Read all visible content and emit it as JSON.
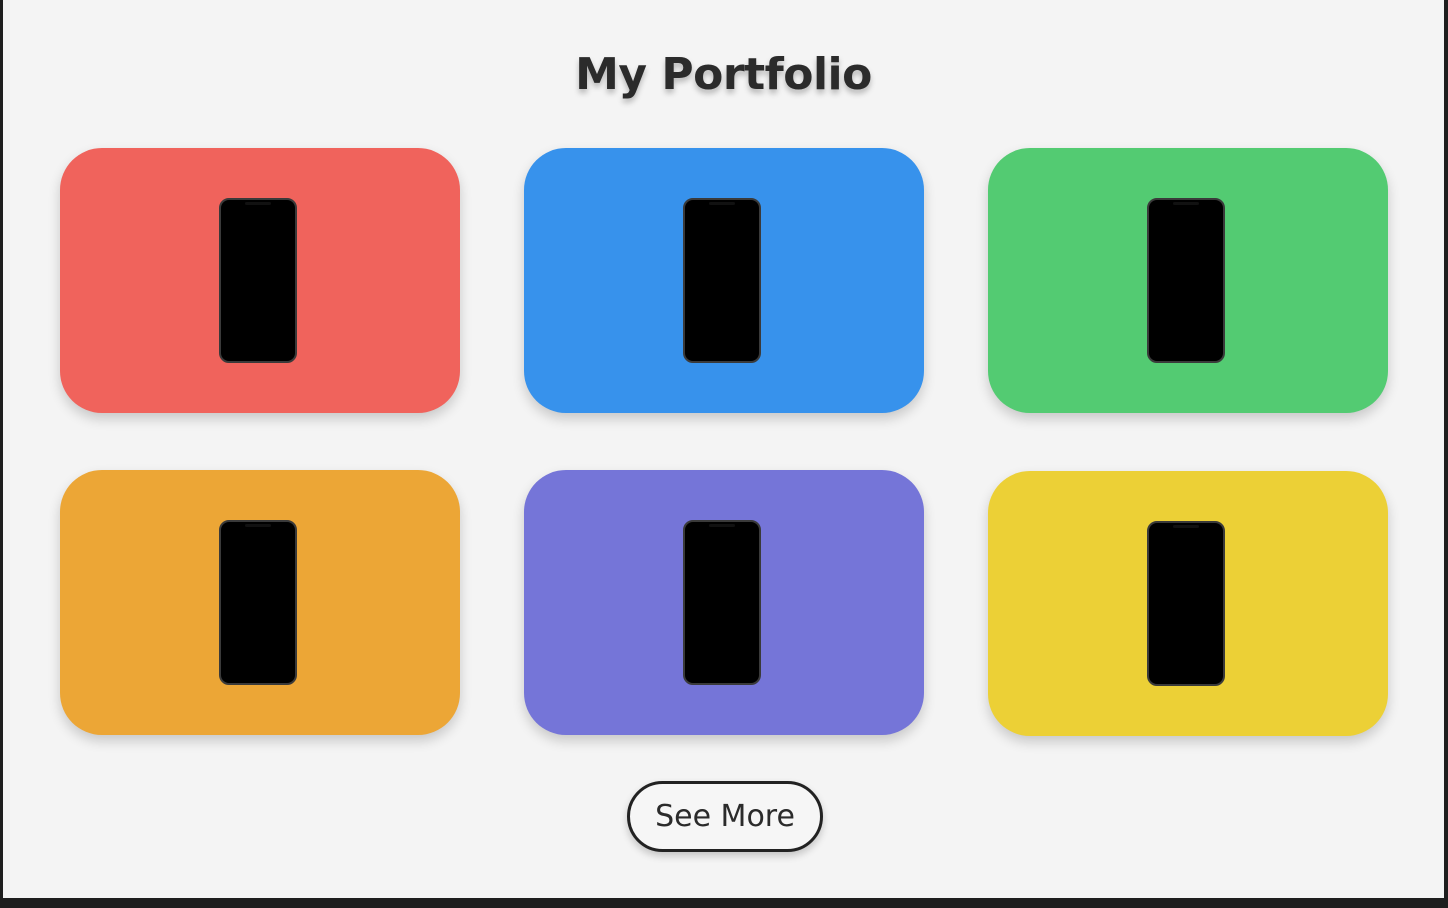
{
  "page": {
    "title": "My Portfolio"
  },
  "portfolio": {
    "items": [
      {
        "color": "#f0635c",
        "preview": "phone-icon"
      },
      {
        "color": "#3792ec",
        "preview": "phone-icon"
      },
      {
        "color": "#53cb72",
        "preview": "phone-icon"
      },
      {
        "color": "#eca636",
        "preview": "phone-icon"
      },
      {
        "color": "#7575d8",
        "preview": "phone-icon"
      },
      {
        "color": "#ecd036",
        "preview": "phone-icon"
      }
    ]
  },
  "actions": {
    "see_more_label": "See More"
  }
}
